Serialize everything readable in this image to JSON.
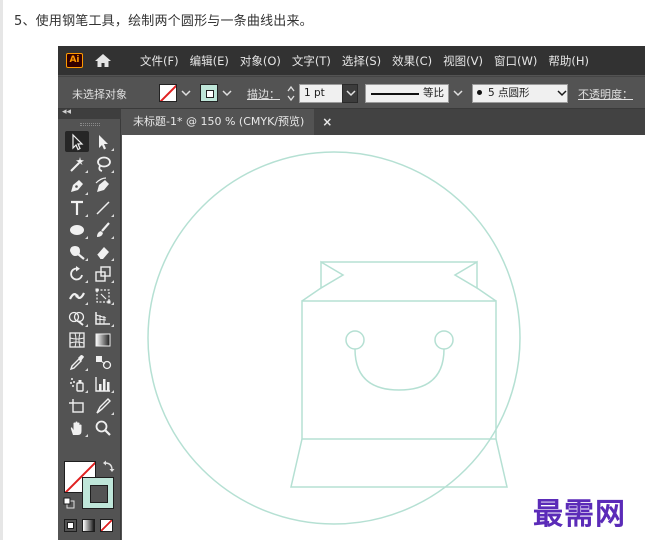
{
  "instruction": "5、使用钢笔工具，绘制两个圆形与一条曲线出来。",
  "app": {
    "logo": "Ai",
    "menus": [
      "文件(F)",
      "编辑(E)",
      "对象(O)",
      "文字(T)",
      "选择(S)",
      "效果(C)",
      "视图(V)",
      "窗口(W)",
      "帮助(H)"
    ],
    "control": {
      "selection_status": "未选择对象",
      "stroke_label": "描边：",
      "stroke_weight": "1 pt",
      "profile_label": "等比",
      "brush_label": "5 点圆形",
      "opacity_label": "不透明度："
    },
    "document_tab": {
      "title": "未标题-1* @ 150 % (CMYK/预览)",
      "close": "×"
    },
    "panel": {
      "collapse": "◂◂"
    },
    "tools": [
      "selection-tool",
      "direct-selection-tool",
      "magic-wand-tool",
      "lasso-tool",
      "pen-tool",
      "curvature-tool",
      "type-tool",
      "line-segment-tool",
      "ellipse-tool",
      "paintbrush-tool",
      "shaper-tool",
      "eraser-tool",
      "rotate-tool",
      "scale-tool",
      "width-tool",
      "free-transform-tool",
      "shape-builder-tool",
      "perspective-grid-tool",
      "mesh-tool",
      "gradient-tool",
      "eyedropper-tool",
      "blend-tool",
      "symbol-sprayer-tool",
      "column-graph-tool",
      "artboard-tool",
      "slice-tool",
      "hand-tool",
      "zoom-tool"
    ],
    "colors": {
      "fill": "none",
      "stroke": "#bfe6d9",
      "art_stroke": "#b5e0d3"
    }
  },
  "watermark": "最需网"
}
